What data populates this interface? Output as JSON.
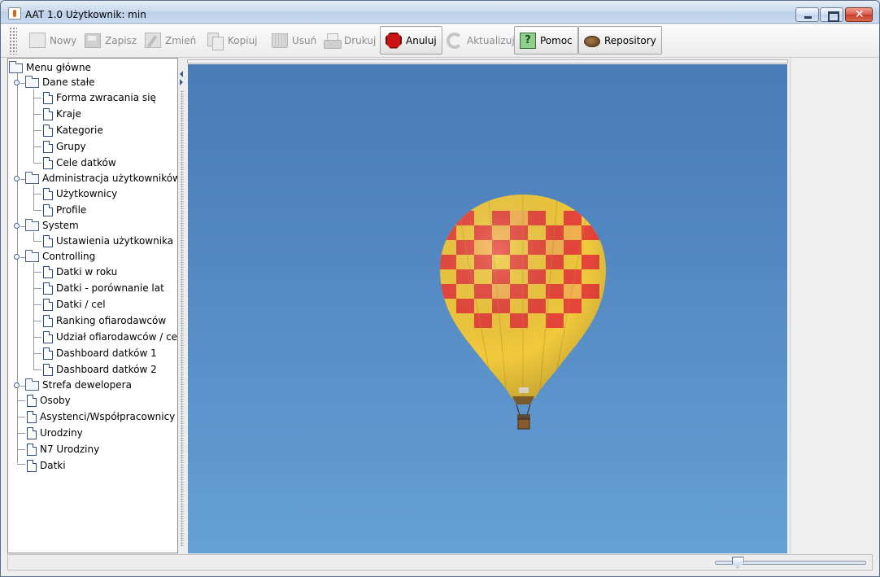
{
  "window": {
    "title": "AAT 1.0  Użytkownik: min",
    "controls": [
      "minimize",
      "maximize",
      "close"
    ]
  },
  "toolbar": {
    "buttons": [
      {
        "label": "Nowy",
        "icon": "new-document-icon",
        "enabled": false
      },
      {
        "label": "Zapisz",
        "icon": "save-icon",
        "enabled": false
      },
      {
        "label": "Zmień",
        "icon": "edit-icon",
        "enabled": false
      },
      {
        "label": "Kopiuj",
        "icon": "copy-icon",
        "enabled": false
      },
      {
        "label": "Usuń",
        "icon": "trash-icon",
        "enabled": false
      },
      {
        "label": "Drukuj",
        "icon": "printer-icon",
        "enabled": false
      },
      {
        "label": "Anuluj",
        "icon": "stop-icon",
        "enabled": true
      },
      {
        "label": "Aktualizuj",
        "icon": "refresh-icon",
        "enabled": false
      },
      {
        "label": "Pomoc",
        "icon": "help-icon",
        "enabled": true
      },
      {
        "label": "Repository",
        "icon": "repository-icon",
        "enabled": true
      }
    ]
  },
  "tree": {
    "root": "Menu główne",
    "groups": [
      {
        "label": "Dane stałe",
        "children": [
          "Forma zwracania się",
          "Kraje",
          "Kategorie",
          "Grupy",
          "Cele datków"
        ]
      },
      {
        "label": "Administracja użytkowników",
        "children": [
          "Użytkownicy",
          "Profile"
        ]
      },
      {
        "label": "System",
        "children": [
          "Ustawienia użytkownika"
        ]
      },
      {
        "label": "Controlling",
        "children": [
          "Datki w roku",
          "Datki - porównanie lat",
          "Datki / cel",
          "Ranking ofiarodawców",
          "Udział ofiarodawców / cel",
          "Dashboard datków 1",
          "Dashboard datków 2"
        ]
      },
      {
        "label": "Strefa dewelopera",
        "children": []
      }
    ],
    "leaves": [
      "Osoby",
      "Asystenci/Współpracownicy",
      "Urodziny",
      "N7 Urodziny",
      "Datki"
    ]
  },
  "content": {
    "image": "hot-air-balloon-photo",
    "colors": {
      "sky_top": "#497cb6",
      "sky_bottom": "#66a0d4",
      "balloon_red": "#e8453a",
      "balloon_yellow": "#f0c43a"
    }
  },
  "statusbar": {
    "zoom_slider_value": 0.12
  }
}
